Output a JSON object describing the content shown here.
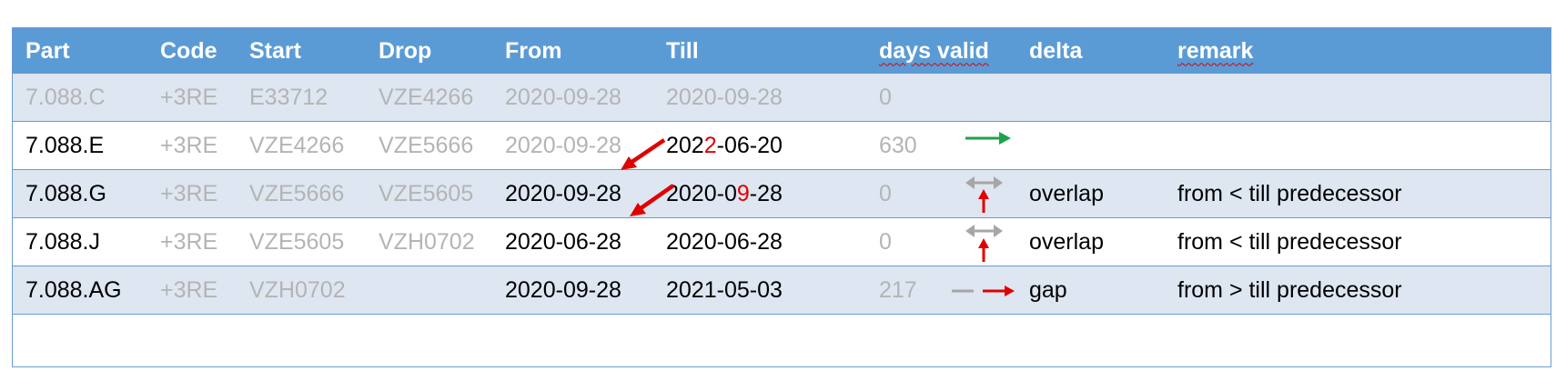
{
  "columns": [
    "Part",
    "Code",
    "Start",
    "Drop",
    "From",
    "Till",
    "days valid",
    "delta",
    "remark"
  ],
  "rows": [
    {
      "part": "7.088.C",
      "code": "+3RE",
      "start": "E33712",
      "drop": "VZE4266",
      "from": "2020-09-28",
      "till": "2020-09-28",
      "days": "0",
      "delta": "",
      "remark": ""
    },
    {
      "part": "7.088.E",
      "code": "+3RE",
      "start": "VZE4266",
      "drop": "VZE5666",
      "from": "2020-09-28",
      "till_a": "202",
      "till_b": "2",
      "till_c": "-06-20",
      "days": "630",
      "delta": "",
      "remark": ""
    },
    {
      "part": "7.088.G",
      "code": "+3RE",
      "start": "VZE5666",
      "drop": "VZE5605",
      "from": "2020-09-28",
      "till_a": "2020-0",
      "till_b": "9",
      "till_c": "-28",
      "days": "0",
      "delta": "overlap",
      "remark": "from < till predecessor"
    },
    {
      "part": "7.088.J",
      "code": "+3RE",
      "start": "VZE5605",
      "drop": "VZH0702",
      "from": "2020-06-28",
      "till": "2020-06-28",
      "days": "0",
      "delta": "overlap",
      "remark": "from < till predecessor"
    },
    {
      "part": "7.088.AG",
      "code": "+3RE",
      "start": "VZH0702",
      "drop": "",
      "from": "2020-09-28",
      "till": "2021-05-03",
      "days": "217",
      "delta": "gap",
      "remark": "from > till predecessor"
    }
  ],
  "delta_icons": [
    "",
    "green-right-arrow-icon",
    "overlap-arrows-icon",
    "overlap-arrows-icon",
    "gap-arrow-icon"
  ],
  "colors": {
    "header_bg": "#5b9bd5",
    "row_shade": "#dde6f1",
    "border": "#6b9bd1",
    "muted_text": "#b4b4b4",
    "highlight_red": "#e00000",
    "arrow_green": "#1ea14a",
    "arrow_grey": "#a6a6a6"
  }
}
